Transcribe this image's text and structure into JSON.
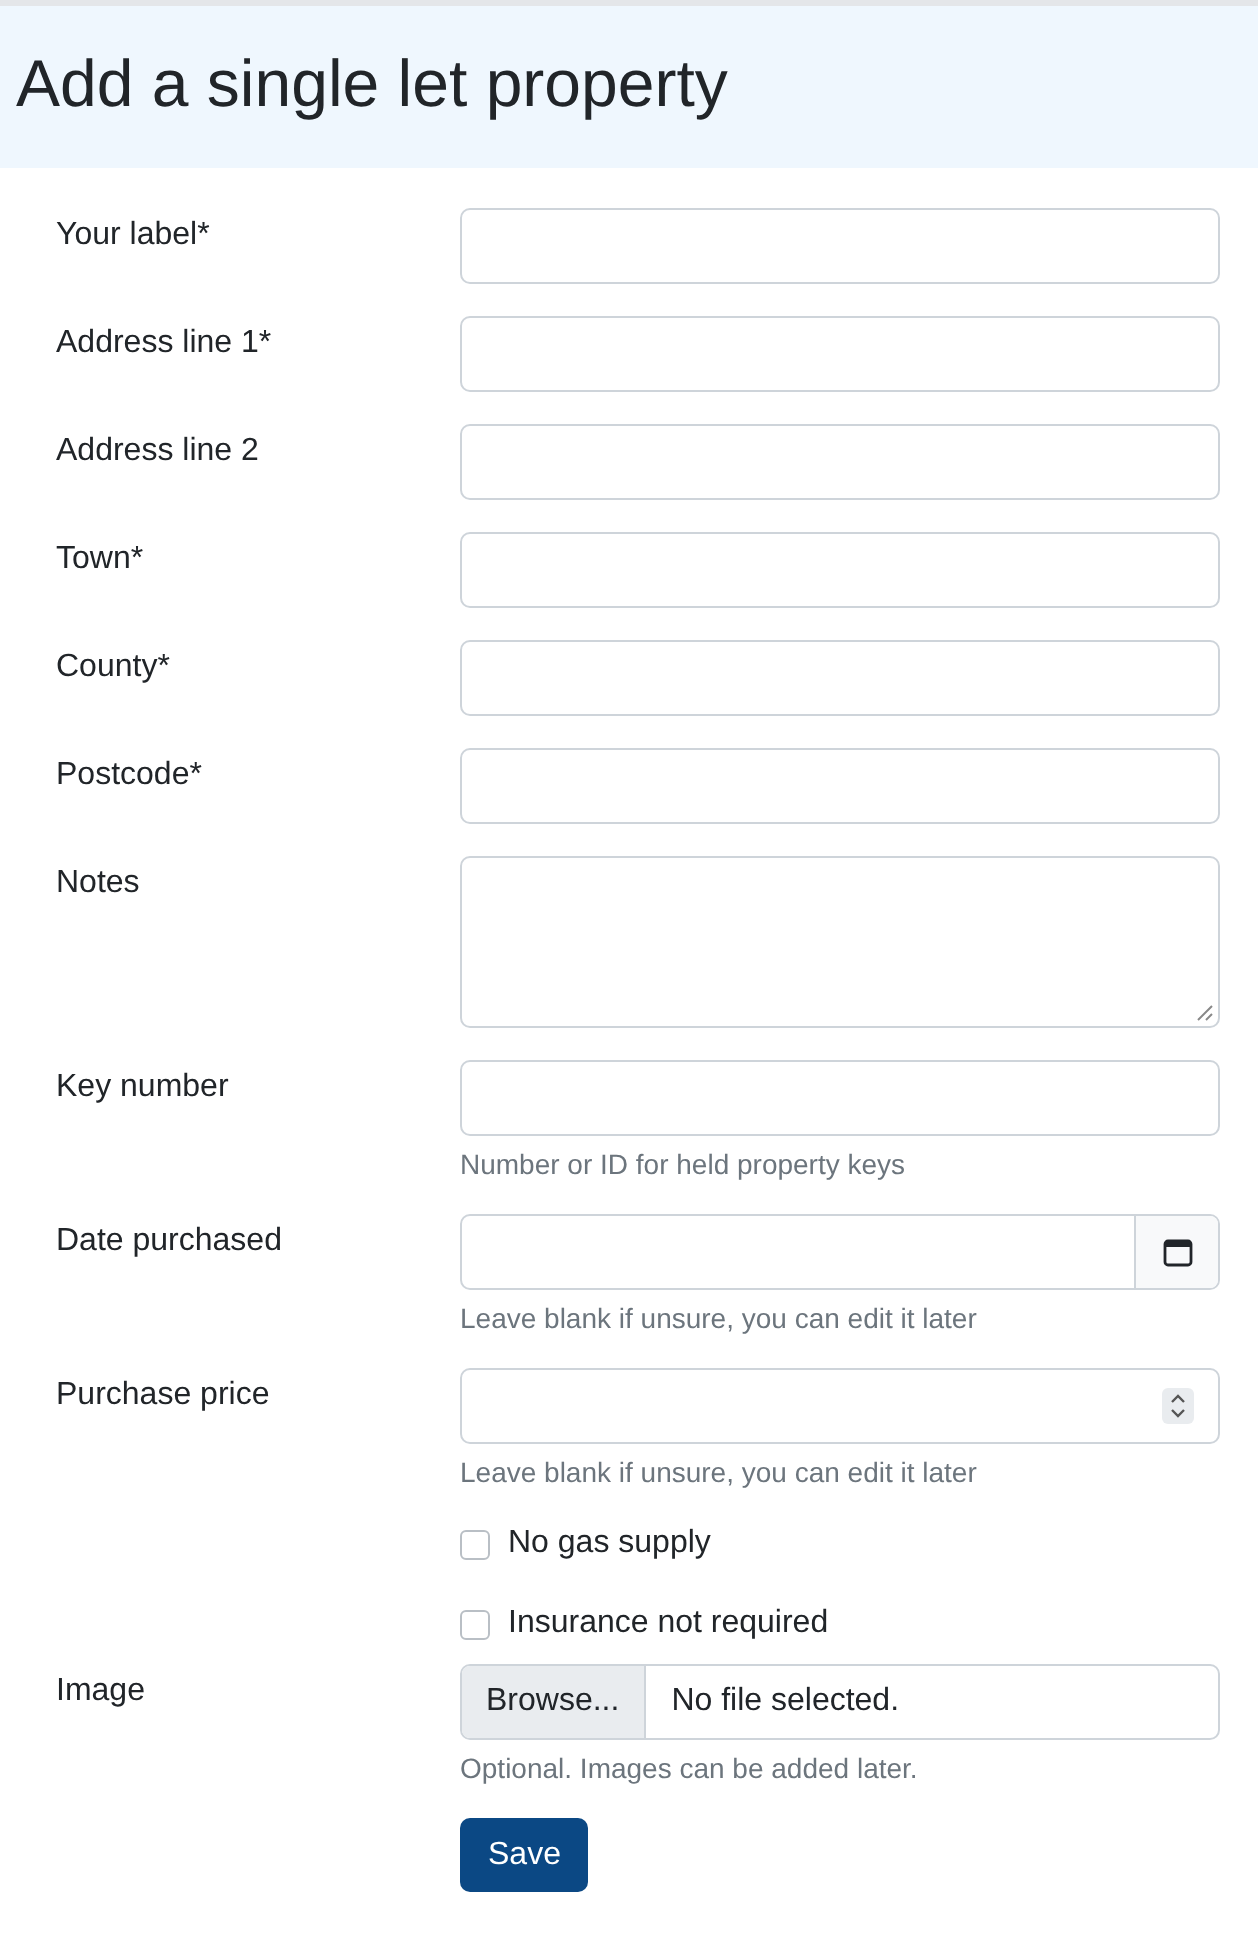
{
  "title": "Add a single let property",
  "fields": [
    {
      "kind": "text",
      "label": "Your label*"
    },
    {
      "kind": "text",
      "label": "Address line 1*"
    },
    {
      "kind": "text",
      "label": "Address line 2"
    },
    {
      "kind": "text",
      "label": "Town*"
    },
    {
      "kind": "text",
      "label": "County*"
    },
    {
      "kind": "text",
      "label": "Postcode*"
    },
    {
      "kind": "textarea",
      "label": "Notes"
    },
    {
      "kind": "text",
      "label": "Key number",
      "help": "Number or ID for held property keys"
    },
    {
      "kind": "date",
      "label": "Date purchased",
      "help": "Leave blank if unsure, you can edit it later"
    },
    {
      "kind": "number",
      "label": "Purchase price",
      "help": "Leave blank if unsure, you can edit it later"
    },
    {
      "kind": "checkbox",
      "label": "No gas supply",
      "checked": false
    },
    {
      "kind": "checkbox",
      "label": "Insurance not required",
      "checked": false
    },
    {
      "kind": "file",
      "label": "Image",
      "button": "Browse...",
      "value": "No file selected.",
      "help": "Optional. Images can be added later."
    }
  ],
  "save": "Save"
}
